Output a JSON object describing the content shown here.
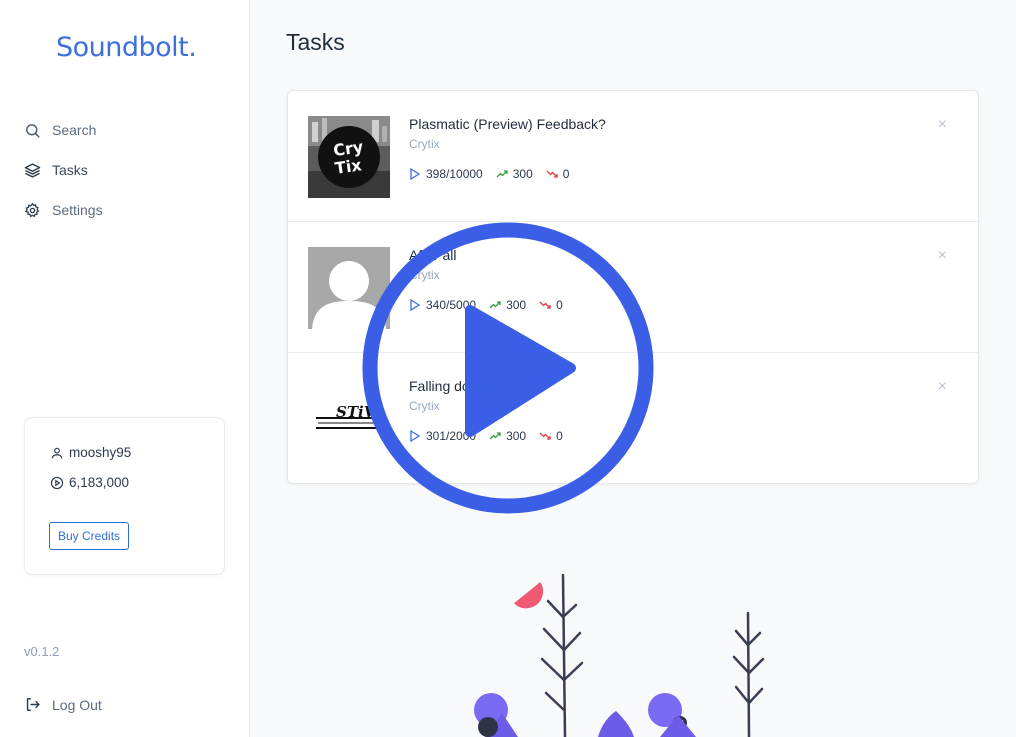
{
  "app": {
    "logo": "Soundbolt."
  },
  "sidebar": {
    "items": [
      {
        "label": "Search",
        "icon": "search-icon"
      },
      {
        "label": "Tasks",
        "icon": "layers-icon"
      },
      {
        "label": "Settings",
        "icon": "gear-icon"
      }
    ],
    "user": {
      "username": "mooshy95",
      "credits": "6,183,000",
      "buy_label": "Buy Credits"
    },
    "version": "v0.1.2",
    "logout_label": "Log Out"
  },
  "main": {
    "title": "Tasks",
    "tasks": [
      {
        "title": "Plasmatic (Preview) Feedback?",
        "artist": "Crytix",
        "plays": "398/10000",
        "up": "300",
        "down": "0",
        "thumb": "crytix-artwork"
      },
      {
        "title": "After all",
        "artist": "Crytix",
        "plays": "340/5000",
        "up": "300",
        "down": "0",
        "thumb": "default-avatar"
      },
      {
        "title": "Falling down",
        "artist": "Crytix",
        "plays": "301/2000",
        "up": "300",
        "down": "0",
        "thumb": "stivi-artwork"
      }
    ],
    "remove_glyph": "×"
  },
  "colors": {
    "accent": "#3d6fe0",
    "up": "#2e9e3e",
    "down": "#e03a3a",
    "play_overlay": "#3a5fe6"
  }
}
